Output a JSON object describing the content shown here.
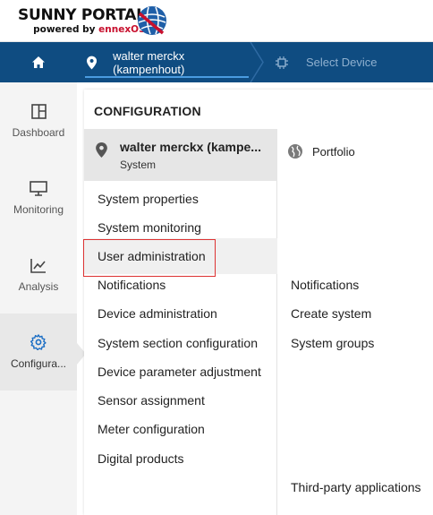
{
  "header": {
    "logo_title": "SUNNY PORTAL",
    "logo_sub_prefix": "powered by ",
    "logo_sub_brand": "ennexOS"
  },
  "navbar": {
    "plant_label": "walter merckx (kampenhout)",
    "device_label": "Select Device"
  },
  "sidebar": {
    "items": [
      {
        "label": "Dashboard",
        "icon": "dashboard-icon"
      },
      {
        "label": "Monitoring",
        "icon": "monitor-icon"
      },
      {
        "label": "Analysis",
        "icon": "chart-line-icon"
      },
      {
        "label": "Configura...",
        "icon": "gear-icon",
        "active": true
      }
    ]
  },
  "panel": {
    "title": "CONFIGURATION",
    "system": {
      "name": "walter merckx (kampe...",
      "type": "System"
    },
    "left_menu": [
      "System properties",
      "System monitoring",
      "User administration",
      "Notifications",
      "Device administration",
      "System section configuration",
      "Device parameter adjustment",
      "Sensor assignment",
      "Meter configuration",
      "Digital products"
    ],
    "portfolio": {
      "label": "Portfolio",
      "icon": "globe-icon"
    },
    "right_menu": [
      "Notifications",
      "Create system",
      "System groups",
      "Third-party applications"
    ]
  },
  "colors": {
    "navbar": "#0f4c81",
    "brand_red": "#c8102e",
    "highlight_border": "#dd3333"
  }
}
